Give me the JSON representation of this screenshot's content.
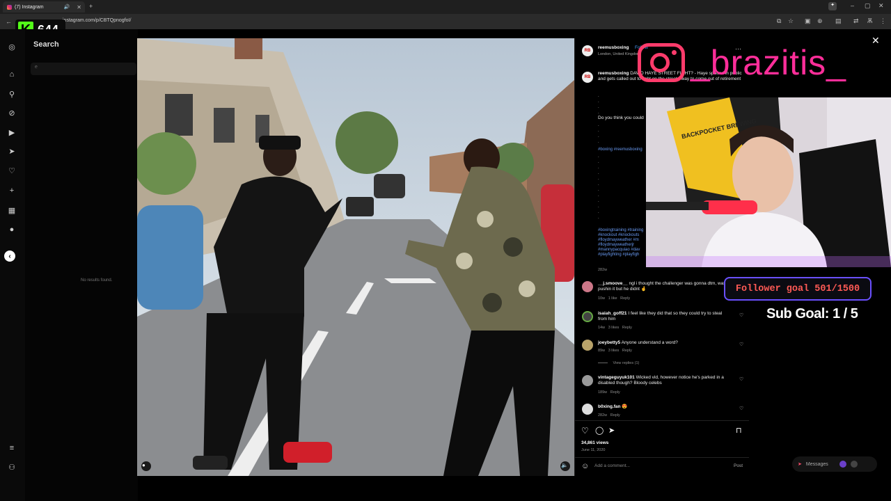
{
  "browser": {
    "tab_title": "(7) Instagram",
    "url": "instagram.com/p/CBTQpnogfoI/"
  },
  "kick": {
    "count": "644"
  },
  "search": {
    "title": "Search",
    "placeholder": "e",
    "empty": "No results found."
  },
  "post": {
    "username": "reemusboxing",
    "follow": "Follow",
    "location": "London, United Kingdom",
    "caption_user": "reemusboxing",
    "caption": "DAVID HAYE STREET FIGHT? - Haye spotted in public and gets called out to fight on the street - way to come out of retirement",
    "question": "Do you think you could",
    "hashtags1": "#boxing #reemusboxing",
    "hashtags2": [
      "#boxingtraining #training",
      "#knockout #knockouts",
      "#floydmayweather #m",
      "#floydmayweatherjr",
      "#mannypacquiao #dav",
      "#playfighting #playfigh"
    ],
    "caption_age": "282w",
    "comments": [
      {
        "user": "__j.smoove__",
        "text": "ngl i thought the challenger was gonna dtm, was pushin it but he didnt 🤞",
        "age": "10w",
        "likes": "1 like",
        "reply": "Reply"
      },
      {
        "user": "isaiah_goff21",
        "text": "I feel like they did that so they could try to steal from him",
        "age": "14w",
        "likes": "3 likes",
        "reply": "Reply"
      },
      {
        "user": "joeybetty5",
        "text": "Anyone understand a word?",
        "age": "89w",
        "likes": "3 likes",
        "reply": "Reply",
        "view_replies": "View replies (1)"
      },
      {
        "user": "vintageguyuk101",
        "text": "Wicked vid, however notice he's parked in a disabled though? Bloody celebs",
        "age": "189w",
        "likes": "",
        "reply": "Reply"
      },
      {
        "user": "b0xing.fan",
        "text": "😍",
        "age": "282w",
        "likes": "",
        "reply": "Reply"
      }
    ],
    "views": "34,861 views",
    "date": "June 11, 2020",
    "add_comment": "Add a comment...",
    "post_btn": "Post"
  },
  "overlay": {
    "brand_name": "_brazitis_",
    "cap_text": "BACKPOCKET BREWING",
    "follower_goal": "Follower goal 501/1500",
    "sub_goal": "Sub Goal:  1 / 5"
  },
  "messages": {
    "label": "Messages"
  }
}
